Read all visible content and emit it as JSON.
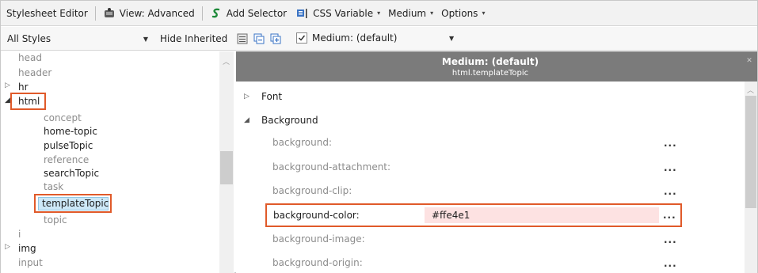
{
  "toolbar": {
    "title": "Stylesheet Editor",
    "view": "View: Advanced",
    "add_selector": "Add Selector",
    "css_variable": "CSS Variable",
    "medium": "Medium",
    "options": "Options"
  },
  "filterbar": {
    "styles_combo": "All Styles",
    "hide_inherited": "Hide Inherited",
    "medium_filter": "Medium: (default)",
    "medium_checked": true
  },
  "tree": {
    "items": [
      {
        "label": "head"
      },
      {
        "label": "header"
      },
      {
        "label": "hr"
      },
      {
        "label": "html"
      },
      {
        "label": "concept"
      },
      {
        "label": "home-topic"
      },
      {
        "label": "pulseTopic"
      },
      {
        "label": "reference"
      },
      {
        "label": "searchTopic"
      },
      {
        "label": "task"
      },
      {
        "label": "templateTopic"
      },
      {
        "label": "topic"
      },
      {
        "label": "i"
      },
      {
        "label": "img"
      },
      {
        "label": "input"
      }
    ]
  },
  "panel": {
    "header_title": "Medium: (default)",
    "header_subtitle": "html.templateTopic",
    "sections": [
      {
        "label": "Font"
      },
      {
        "label": "Background"
      }
    ],
    "properties": [
      {
        "name": "background:",
        "value": ""
      },
      {
        "name": "background-attachment:",
        "value": ""
      },
      {
        "name": "background-clip:",
        "value": ""
      },
      {
        "name": "background-color:",
        "value": "#ffe4e1"
      },
      {
        "name": "background-image:",
        "value": ""
      },
      {
        "name": "background-origin:",
        "value": ""
      }
    ],
    "ellipsis": "..."
  },
  "colors": {
    "highlight_border": "#e05a2a",
    "value_background": "#fde2e2",
    "header_background": "#7b7b7b",
    "selection_background": "#cde8f7"
  }
}
